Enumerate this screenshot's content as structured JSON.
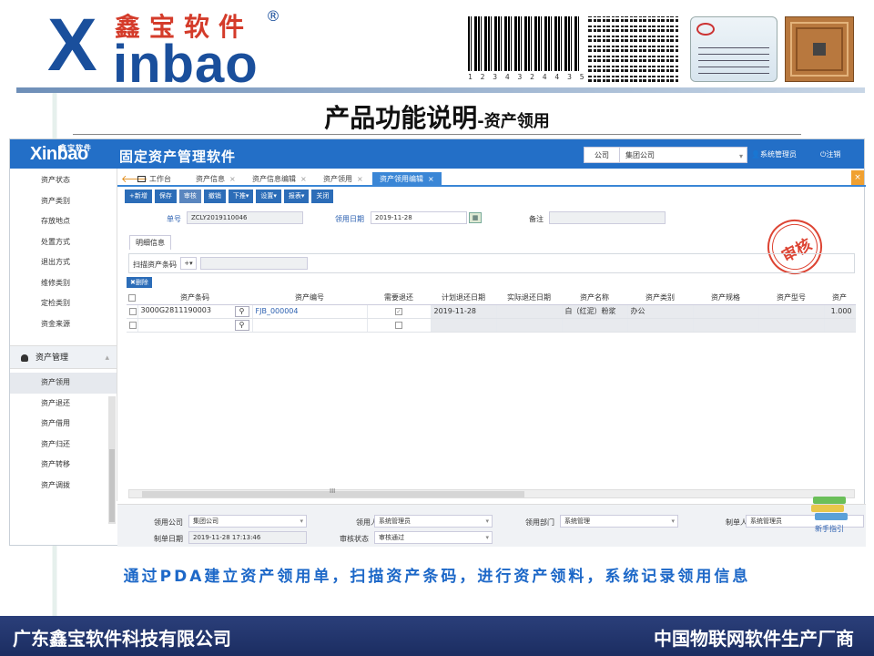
{
  "slide": {
    "logo_cn": "鑫宝软件",
    "logo_x": "X",
    "logo_en": "inbao",
    "logo_reg": "®",
    "barcode_number": "1 2 3 4 3 2 4 4 3 5 1 1 1",
    "title_main": "产品功能说明",
    "title_sub": "-资产领用",
    "caption": "通过PDA建立资产领用单，扫描资产条码，进行资产领料，系统记录领用信息",
    "footer_left": "广东鑫宝软件科技有限公司",
    "footer_right": "中国物联网软件生产厂商"
  },
  "app": {
    "logo": "Xinbao",
    "logo_cn": "鑫宝软件",
    "title": "固定资产管理软件",
    "company_label": "公司",
    "company_value": "集团公司",
    "user": "系统管理员",
    "logout": "注销",
    "accent_color": "#236fc7"
  },
  "sidebar": {
    "items_top": [
      "资产状态",
      "资产类别",
      "存放地点",
      "处置方式",
      "退出方式",
      "维修类别",
      "定检类别",
      "资金来源"
    ],
    "group_label": "资产管理",
    "items_group": [
      "资产领用",
      "资产退还",
      "资产借用",
      "资产归还",
      "资产转移",
      "资产调拨"
    ]
  },
  "tabs": [
    "工作台",
    "资产信息",
    "资产信息编辑",
    "资产领用",
    "资产领用编辑"
  ],
  "toolbar": [
    "+新增",
    "保存",
    "审核",
    "撤销",
    "下推▾",
    "设置▾",
    "报表▾",
    "关闭"
  ],
  "form": {
    "doc_no_label": "单号",
    "doc_no": "ZCLY2019110046",
    "date_label": "领用日期",
    "date": "2019-11-28",
    "remark_label": "备注",
    "remark": ""
  },
  "stamp": "审核",
  "detail_tab": "明细信息",
  "scan_label": "扫描资产条码",
  "scan_plus": "+",
  "delete_button": "删除",
  "grid": {
    "columns": [
      "资产条码",
      "资产编号",
      "需要退还",
      "计划退还日期",
      "实际退还日期",
      "资产名称",
      "资产类别",
      "资产规格",
      "资产型号",
      "资产"
    ],
    "rows": [
      {
        "barcode": "3000G2811190003",
        "asset_no": "FJB_000004",
        "need_return": true,
        "plan_date": "2019-11-28",
        "actual_date": "",
        "name": "白（红泥）粉浆",
        "category": "办公",
        "spec": "",
        "model": "",
        "qty": "1.000"
      },
      {
        "barcode": "",
        "asset_no": "",
        "need_return": false,
        "plan_date": "",
        "actual_date": "",
        "name": "",
        "category": "",
        "spec": "",
        "model": "",
        "qty": ""
      }
    ]
  },
  "scrollbar_mid": "III",
  "footer_form": {
    "company_label": "领用公司",
    "company": "集团公司",
    "person_label": "领用人",
    "person": "系统管理员",
    "dept_label": "领用部门",
    "dept": "系统管理",
    "maker_label": "制单人",
    "maker": "系统管理员",
    "made_date_label": "制单日期",
    "made_date": "2019-11-28 17:13:46",
    "audit_label": "审核状态",
    "audit": "审核通过"
  },
  "help_label": "新手指引"
}
